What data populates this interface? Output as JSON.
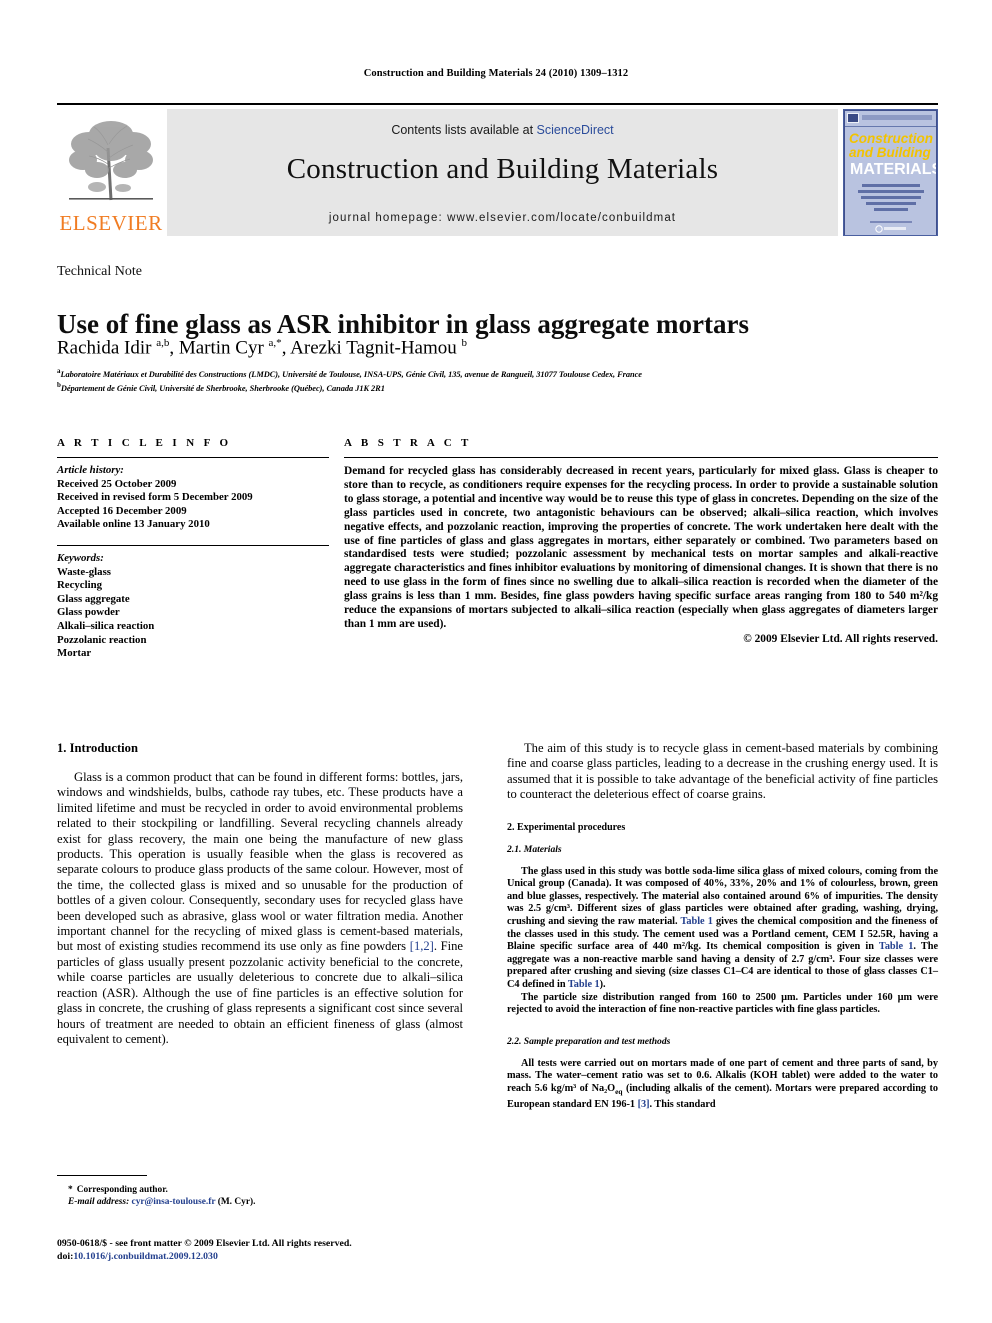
{
  "running_head": "Construction and Building Materials 24 (2010) 1309–1312",
  "masthead": {
    "contents_prefix": "Contents lists available at ",
    "sciencedirect": "ScienceDirect",
    "journal_title": "Construction and Building Materials",
    "homepage": "journal homepage: www.elsevier.com/locate/conbuildmat",
    "publisher": "ELSEVIER",
    "cover": {
      "line1": "Construction",
      "line2": "and Building",
      "line3": "MATERIALS",
      "blurb": "An International Journal Dedicated to the Investigation and Innovative Use of Materials in Construction and Repair",
      "footer": "ScienceDirect"
    },
    "accent_orange": "#F07C23",
    "link_blue": "#2b4c9b",
    "banner_bg": "#e6e6e6"
  },
  "article": {
    "doctype": "Technical Note",
    "title": "Use of fine glass as ASR inhibitor in glass aggregate mortars",
    "authors_html": "Rachida Idir <sup>a,b</sup>, Martin Cyr <sup>a,*</sup>, Arezki Tagnit-Hamou <sup>b</sup>",
    "affiliation_a": "Laboratoire Matériaux et Durabilité des Constructions (LMDC), Université de Toulouse, INSA-UPS, Génie Civil, 135, avenue de Rangueil, 31077 Toulouse Cedex, France",
    "affiliation_b": "Département de Génie Civil, Université de Sherbrooke, Sherbrooke (Québec), Canada J1K 2R1"
  },
  "info": {
    "heading": "A R T I C L E    I N F O",
    "history_label": "Article history:",
    "history": [
      "Received 25 October 2009",
      "Received in revised form 5 December 2009",
      "Accepted 16 December 2009",
      "Available online 13 January 2010"
    ],
    "keywords_label": "Keywords:",
    "keywords": [
      "Waste-glass",
      "Recycling",
      "Glass aggregate",
      "Glass powder",
      "Alkali–silica reaction",
      "Pozzolanic reaction",
      "Mortar"
    ]
  },
  "abstract": {
    "heading": "A B S T R A C T",
    "text": "Demand for recycled glass has considerably decreased in recent years, particularly for mixed glass. Glass is cheaper to store than to recycle, as conditioners require expenses for the recycling process. In order to provide a sustainable solution to glass storage, a potential and incentive way would be to reuse this type of glass in concretes. Depending on the size of the glass particles used in concrete, two antagonistic behaviours can be observed; alkali–silica reaction, which involves negative effects, and pozzolanic reaction, improving the properties of concrete. The work undertaken here dealt with the use of fine particles of glass and glass aggregates in mortars, either separately or combined. Two parameters based on standardised tests were studied; pozzolanic assessment by mechanical tests on mortar samples and alkali-reactive aggregate characteristics and fines inhibitor evaluations by monitoring of dimensional changes. It is shown that there is no need to use glass in the form of fines since no swelling due to alkali–silica reaction is recorded when the diameter of the glass grains is less than 1 mm. Besides, fine glass powders having specific surface areas ranging from 180 to 540 m²/kg reduce the expansions of mortars subjected to alkali–silica reaction (especially when glass aggregates of diameters larger than 1 mm are used).",
    "copyright": "© 2009 Elsevier Ltd. All rights reserved."
  },
  "body": {
    "intro_heading": "1. Introduction",
    "intro_p1_a": "Glass is a common product that can be found in different forms: bottles, jars, windows and windshields, bulbs, cathode ray tubes, etc. These products have a limited lifetime and must be recycled in order to avoid environmental problems related to their stockpiling or landfilling. Several recycling channels already exist for glass recovery, the main one being the manufacture of new glass products. This operation is usually feasible when the glass is recovered as separate colours to produce glass products of the same colour. However, most of the time, the collected glass is mixed and so unusable for the production of bottles of a given colour. Consequently, secondary uses for recycled glass have been developed such as abrasive, glass wool or water filtration media. Another important channel for the recycling of mixed glass is cement-based materials, but most of existing studies recommend its use only as fine powders ",
    "intro_ref1": "[1,2]",
    "intro_p1_b": ". Fine particles of glass usually present pozzolanic activity beneficial to the concrete, while coarse particles are usually deleterious to concrete due to alkali–silica reaction (ASR). Although the use of fine particles is an effective solution for glass in concrete, the crushing of glass represents a significant cost since several hours of treatment are needed to obtain an efficient fineness of glass (almost equivalent to cement).",
    "aim_p": "The aim of this study is to recycle glass in cement-based materials by combining fine and coarse glass particles, leading to a decrease in the crushing energy used. It is assumed that it is possible to take advantage of the beneficial activity of fine particles to counteract the deleterious effect of coarse grains.",
    "exp_heading": "2. Experimental procedures",
    "mat_heading": "2.1. Materials",
    "mat_p1_a": "The glass used in this study was bottle soda-lime silica glass of mixed colours, coming from the Unical group (Canada). It was composed of 40%, 33%, 20% and 1% of colourless, brown, green and blue glasses, respectively. The material also contained around 6% of impurities. The density was 2.5 g/cm³. Different sizes of glass particles were obtained after grading, washing, drying, crushing and sieving the raw material. ",
    "mat_ref_t1a": "Table 1",
    "mat_p1_b": " gives the chemical composition and the fineness of the classes used in this study. The cement used was a Portland cement, CEM I 52.5R, having a Blaine specific surface area of 440 m²/kg. Its chemical composition is given in ",
    "mat_ref_t1b": "Table 1",
    "mat_p1_c": ". The aggregate was a non-reactive marble sand having a density of 2.7 g/cm³. Four size classes were prepared after crushing and sieving (size classes C1–C4 are identical to those of glass classes C1–C4 defined in ",
    "mat_ref_t1c": "Table 1",
    "mat_p1_d": ").",
    "mat_p2": "The particle size distribution ranged from 160 to 2500 µm. Particles under 160 µm were rejected to avoid the interaction of fine non-reactive particles with fine glass particles.",
    "sample_heading": "2.2. Sample preparation and test methods",
    "sample_p1_a": "All tests were carried out on mortars made of one part of cement and three parts of sand, by mass. The water–cement ratio was set to 0.6. Alkalis (KOH tablet) were added to the water to reach 5.6 kg/m³ of Na₂O",
    "sample_sub": "eq",
    "sample_p1_b": " (including alkalis of the cement). Mortars were prepared according to European standard EN 196-1 ",
    "sample_ref3": "[3]",
    "sample_p1_c": ". This standard"
  },
  "footnote": {
    "star": "*",
    "corresponding": "Corresponding author.",
    "email_label": "E-mail address:",
    "email": "cyr@insa-toulouse.fr",
    "email_suffix": "(M. Cyr).",
    "issn_line": "0950-0618/$ - see front matter © 2009 Elsevier Ltd. All rights reserved.",
    "doi_label": "doi:",
    "doi": "10.1016/j.conbuildmat.2009.12.030"
  }
}
